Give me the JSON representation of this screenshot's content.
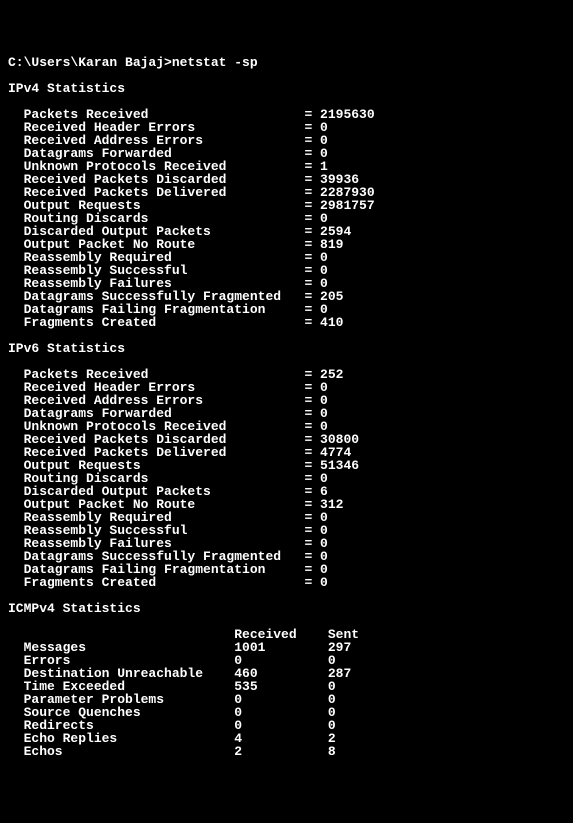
{
  "prompt": "C:\\Users\\Karan Bajaj>netstat -sp",
  "sections": [
    {
      "title": "IPv4 Statistics",
      "rows": [
        {
          "label": "Packets Received",
          "value": "2195630"
        },
        {
          "label": "Received Header Errors",
          "value": "0"
        },
        {
          "label": "Received Address Errors",
          "value": "0"
        },
        {
          "label": "Datagrams Forwarded",
          "value": "0"
        },
        {
          "label": "Unknown Protocols Received",
          "value": "1"
        },
        {
          "label": "Received Packets Discarded",
          "value": "39936"
        },
        {
          "label": "Received Packets Delivered",
          "value": "2287930"
        },
        {
          "label": "Output Requests",
          "value": "2981757"
        },
        {
          "label": "Routing Discards",
          "value": "0"
        },
        {
          "label": "Discarded Output Packets",
          "value": "2594"
        },
        {
          "label": "Output Packet No Route",
          "value": "819"
        },
        {
          "label": "Reassembly Required",
          "value": "0"
        },
        {
          "label": "Reassembly Successful",
          "value": "0"
        },
        {
          "label": "Reassembly Failures",
          "value": "0"
        },
        {
          "label": "Datagrams Successfully Fragmented",
          "value": "205"
        },
        {
          "label": "Datagrams Failing Fragmentation",
          "value": "0"
        },
        {
          "label": "Fragments Created",
          "value": "410"
        }
      ]
    },
    {
      "title": "IPv6 Statistics",
      "rows": [
        {
          "label": "Packets Received",
          "value": "252"
        },
        {
          "label": "Received Header Errors",
          "value": "0"
        },
        {
          "label": "Received Address Errors",
          "value": "0"
        },
        {
          "label": "Datagrams Forwarded",
          "value": "0"
        },
        {
          "label": "Unknown Protocols Received",
          "value": "0"
        },
        {
          "label": "Received Packets Discarded",
          "value": "30800"
        },
        {
          "label": "Received Packets Delivered",
          "value": "4774"
        },
        {
          "label": "Output Requests",
          "value": "51346"
        },
        {
          "label": "Routing Discards",
          "value": "0"
        },
        {
          "label": "Discarded Output Packets",
          "value": "6"
        },
        {
          "label": "Output Packet No Route",
          "value": "312"
        },
        {
          "label": "Reassembly Required",
          "value": "0"
        },
        {
          "label": "Reassembly Successful",
          "value": "0"
        },
        {
          "label": "Reassembly Failures",
          "value": "0"
        },
        {
          "label": "Datagrams Successfully Fragmented",
          "value": "0"
        },
        {
          "label": "Datagrams Failing Fragmentation",
          "value": "0"
        },
        {
          "label": "Fragments Created",
          "value": "0"
        }
      ]
    }
  ],
  "icmp": {
    "title": "ICMPv4 Statistics",
    "header_received": "Received",
    "header_sent": "Sent",
    "rows": [
      {
        "label": "Messages",
        "received": "1001",
        "sent": "297"
      },
      {
        "label": "Errors",
        "received": "0",
        "sent": "0"
      },
      {
        "label": "Destination Unreachable",
        "received": "460",
        "sent": "287"
      },
      {
        "label": "Time Exceeded",
        "received": "535",
        "sent": "0"
      },
      {
        "label": "Parameter Problems",
        "received": "0",
        "sent": "0"
      },
      {
        "label": "Source Quenches",
        "received": "0",
        "sent": "0"
      },
      {
        "label": "Redirects",
        "received": "0",
        "sent": "0"
      },
      {
        "label": "Echo Replies",
        "received": "4",
        "sent": "2"
      },
      {
        "label": "Echos",
        "received": "2",
        "sent": "8"
      }
    ]
  }
}
